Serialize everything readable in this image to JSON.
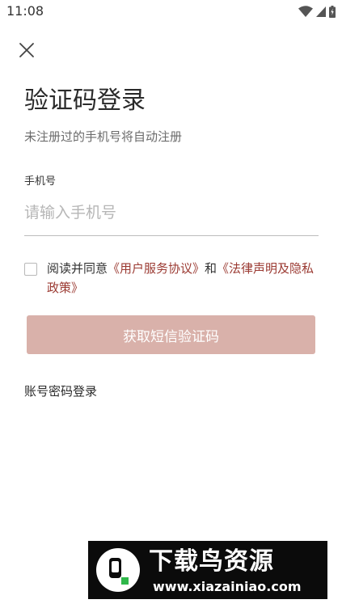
{
  "status_bar": {
    "time": "11:08",
    "icons": [
      "wifi-icon",
      "cellular-icon",
      "battery-icon"
    ]
  },
  "close_icon": "close-icon",
  "title": "验证码登录",
  "subtitle": "未注册过的手机号将自动注册",
  "phone": {
    "label": "手机号",
    "placeholder": "请输入手机号",
    "value": ""
  },
  "agreement": {
    "checked": false,
    "prefix": "阅读并同意",
    "link1": "《用户服务协议》",
    "conjunction": "和",
    "link2": "《法律声明及隐私政策》"
  },
  "get_code_button": "获取短信验证码",
  "password_login": "账号密码登录",
  "watermark": {
    "title": "下载鸟资源",
    "url": "www.xiazainiao.com"
  },
  "colors": {
    "link": "#9b3a32",
    "button": "#d9b1aa",
    "placeholder": "#b6b6b6"
  }
}
